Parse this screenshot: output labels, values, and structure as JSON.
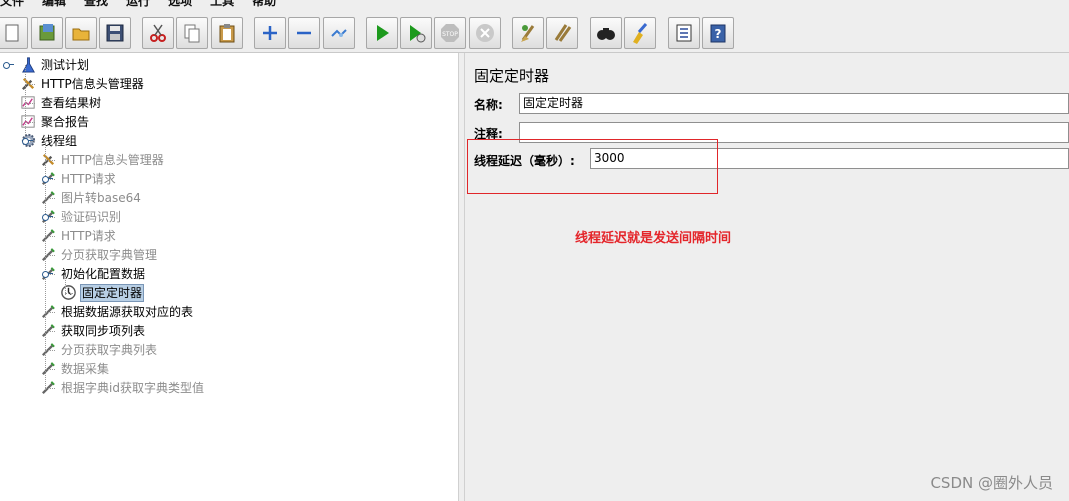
{
  "menu": [
    "文件",
    "编辑",
    "查找",
    "运行",
    "选项",
    "工具",
    "帮助"
  ],
  "toolbar": [
    {
      "name": "new-icon"
    },
    {
      "name": "templates-icon"
    },
    {
      "name": "open-icon"
    },
    {
      "name": "save-icon"
    },
    {
      "name": "cut-icon"
    },
    {
      "name": "copy-icon"
    },
    {
      "name": "paste-icon"
    },
    {
      "name": "expand-icon"
    },
    {
      "name": "collapse-icon"
    },
    {
      "name": "toggle-icon"
    },
    {
      "name": "start-icon"
    },
    {
      "name": "start-no-pause-icon"
    },
    {
      "name": "stop-icon"
    },
    {
      "name": "shutdown-icon"
    },
    {
      "name": "clear-icon"
    },
    {
      "name": "clear-all-icon"
    },
    {
      "name": "search-icon"
    },
    {
      "name": "reset-search-icon"
    },
    {
      "name": "function-helper-icon"
    },
    {
      "name": "help-icon"
    }
  ],
  "tree": [
    {
      "label": "测试计划",
      "icon": "test-plan-icon",
      "disabled": false
    },
    {
      "label": "HTTP信息头管理器",
      "icon": "wrench-icon",
      "disabled": false
    },
    {
      "label": "查看结果树",
      "icon": "listener-icon",
      "disabled": false
    },
    {
      "label": "聚合报告",
      "icon": "listener-icon",
      "disabled": false
    },
    {
      "label": "线程组",
      "icon": "gear-icon",
      "disabled": false
    },
    {
      "label": "HTTP信息头管理器",
      "icon": "wrench-icon",
      "disabled": true
    },
    {
      "label": "HTTP请求",
      "icon": "sampler-icon",
      "disabled": true
    },
    {
      "label": "图片转base64",
      "icon": "sampler-icon",
      "disabled": true
    },
    {
      "label": "验证码识别",
      "icon": "sampler-icon",
      "disabled": true
    },
    {
      "label": "HTTP请求",
      "icon": "sampler-icon",
      "disabled": true
    },
    {
      "label": "分页获取字典管理",
      "icon": "sampler-icon",
      "disabled": true
    },
    {
      "label": "初始化配置数据",
      "icon": "sampler-icon",
      "disabled": false
    },
    {
      "label": "固定定时器",
      "icon": "timer-icon",
      "disabled": false,
      "selected": true
    },
    {
      "label": "根据数据源获取对应的表",
      "icon": "sampler-icon",
      "disabled": false
    },
    {
      "label": "获取同步项列表",
      "icon": "sampler-icon",
      "disabled": false
    },
    {
      "label": "分页获取字典列表",
      "icon": "sampler-icon",
      "disabled": true
    },
    {
      "label": "数据采集",
      "icon": "sampler-icon",
      "disabled": true
    },
    {
      "label": "根据字典id获取字典类型值",
      "icon": "sampler-icon",
      "disabled": true
    }
  ],
  "panel": {
    "title": "固定定时器",
    "name_label": "名称:",
    "name_value": "固定定时器",
    "comment_label": "注释:",
    "comment_value": "",
    "delay_label": "线程延迟（毫秒）:",
    "delay_value": "3000"
  },
  "annotation": "线程延迟就是发送间隔时间",
  "watermark": "CSDN @圈外人员",
  "colors": {
    "annotation": "#e4252a",
    "selection": "#b8cfe5"
  }
}
